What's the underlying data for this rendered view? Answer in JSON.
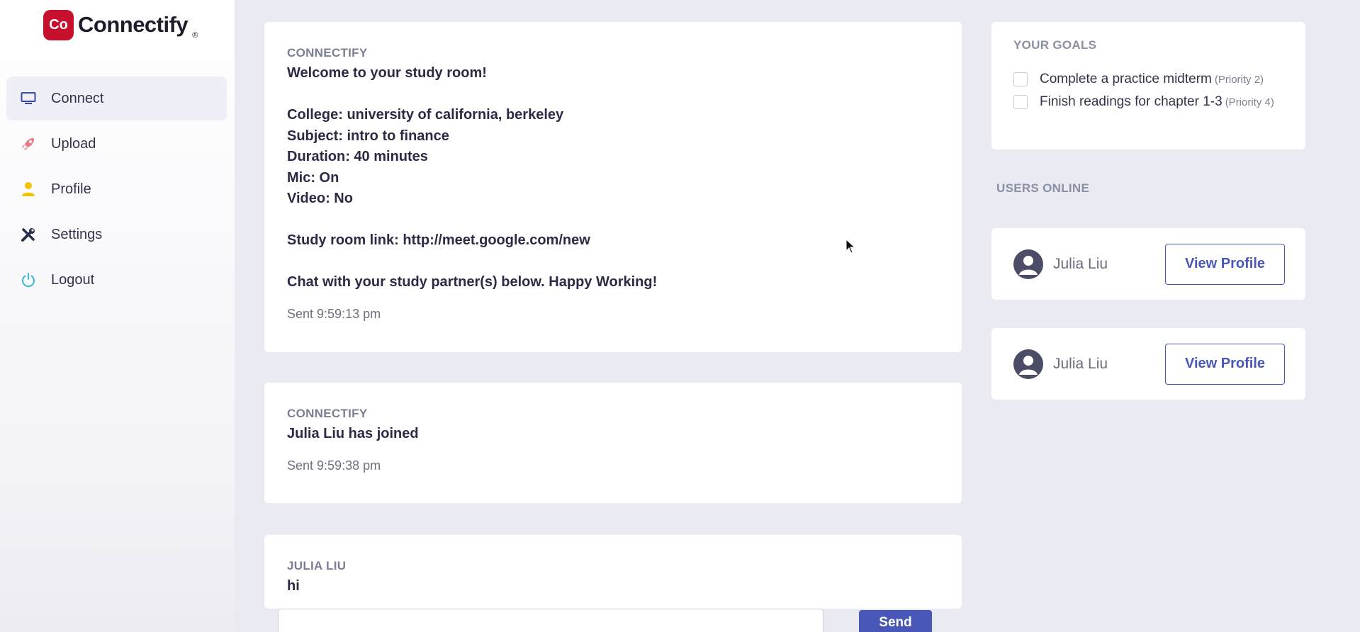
{
  "brand": {
    "logo_mark": "Co",
    "name": "Connectify",
    "reg": "®",
    "color": "#c8102e"
  },
  "sidebar": {
    "items": [
      {
        "label": "Connect",
        "icon": "monitor-icon",
        "active": true
      },
      {
        "label": "Upload",
        "icon": "rocket-icon",
        "active": false
      },
      {
        "label": "Profile",
        "icon": "person-icon",
        "active": false
      },
      {
        "label": "Settings",
        "icon": "tools-icon",
        "active": false
      },
      {
        "label": "Logout",
        "icon": "power-icon",
        "active": false
      }
    ]
  },
  "chat": {
    "messages": [
      {
        "sender": "CONNECTIFY",
        "body": "Welcome to your study room!\n\nCollege: university of california, berkeley\nSubject: intro to finance\nDuration: 40 minutes\nMic: On\nVideo: No\n\nStudy room link: http://meet.google.com/new\n\nChat with your study partner(s) below. Happy Working!",
        "time": "Sent 9:59:13 pm"
      },
      {
        "sender": "CONNECTIFY",
        "body": "Julia Liu has joined",
        "time": "Sent 9:59:38 pm"
      },
      {
        "sender": "JULIA LIU",
        "body": "hi",
        "time": ""
      }
    ],
    "input_value": "",
    "send_label": "Send"
  },
  "goals": {
    "title": "YOUR GOALS",
    "items": [
      {
        "text": "Complete a practice midterm",
        "priority": "(Priority 2)",
        "checked": false
      },
      {
        "text": "Finish readings for chapter 1-3",
        "priority": "(Priority 4)",
        "checked": false
      }
    ]
  },
  "users_online": {
    "title": "USERS ONLINE",
    "users": [
      {
        "name": "Julia Liu",
        "button": "View Profile"
      },
      {
        "name": "Julia Liu",
        "button": "View Profile"
      }
    ]
  },
  "colors": {
    "accent": "#4857b8",
    "brand_red": "#c8102e"
  }
}
